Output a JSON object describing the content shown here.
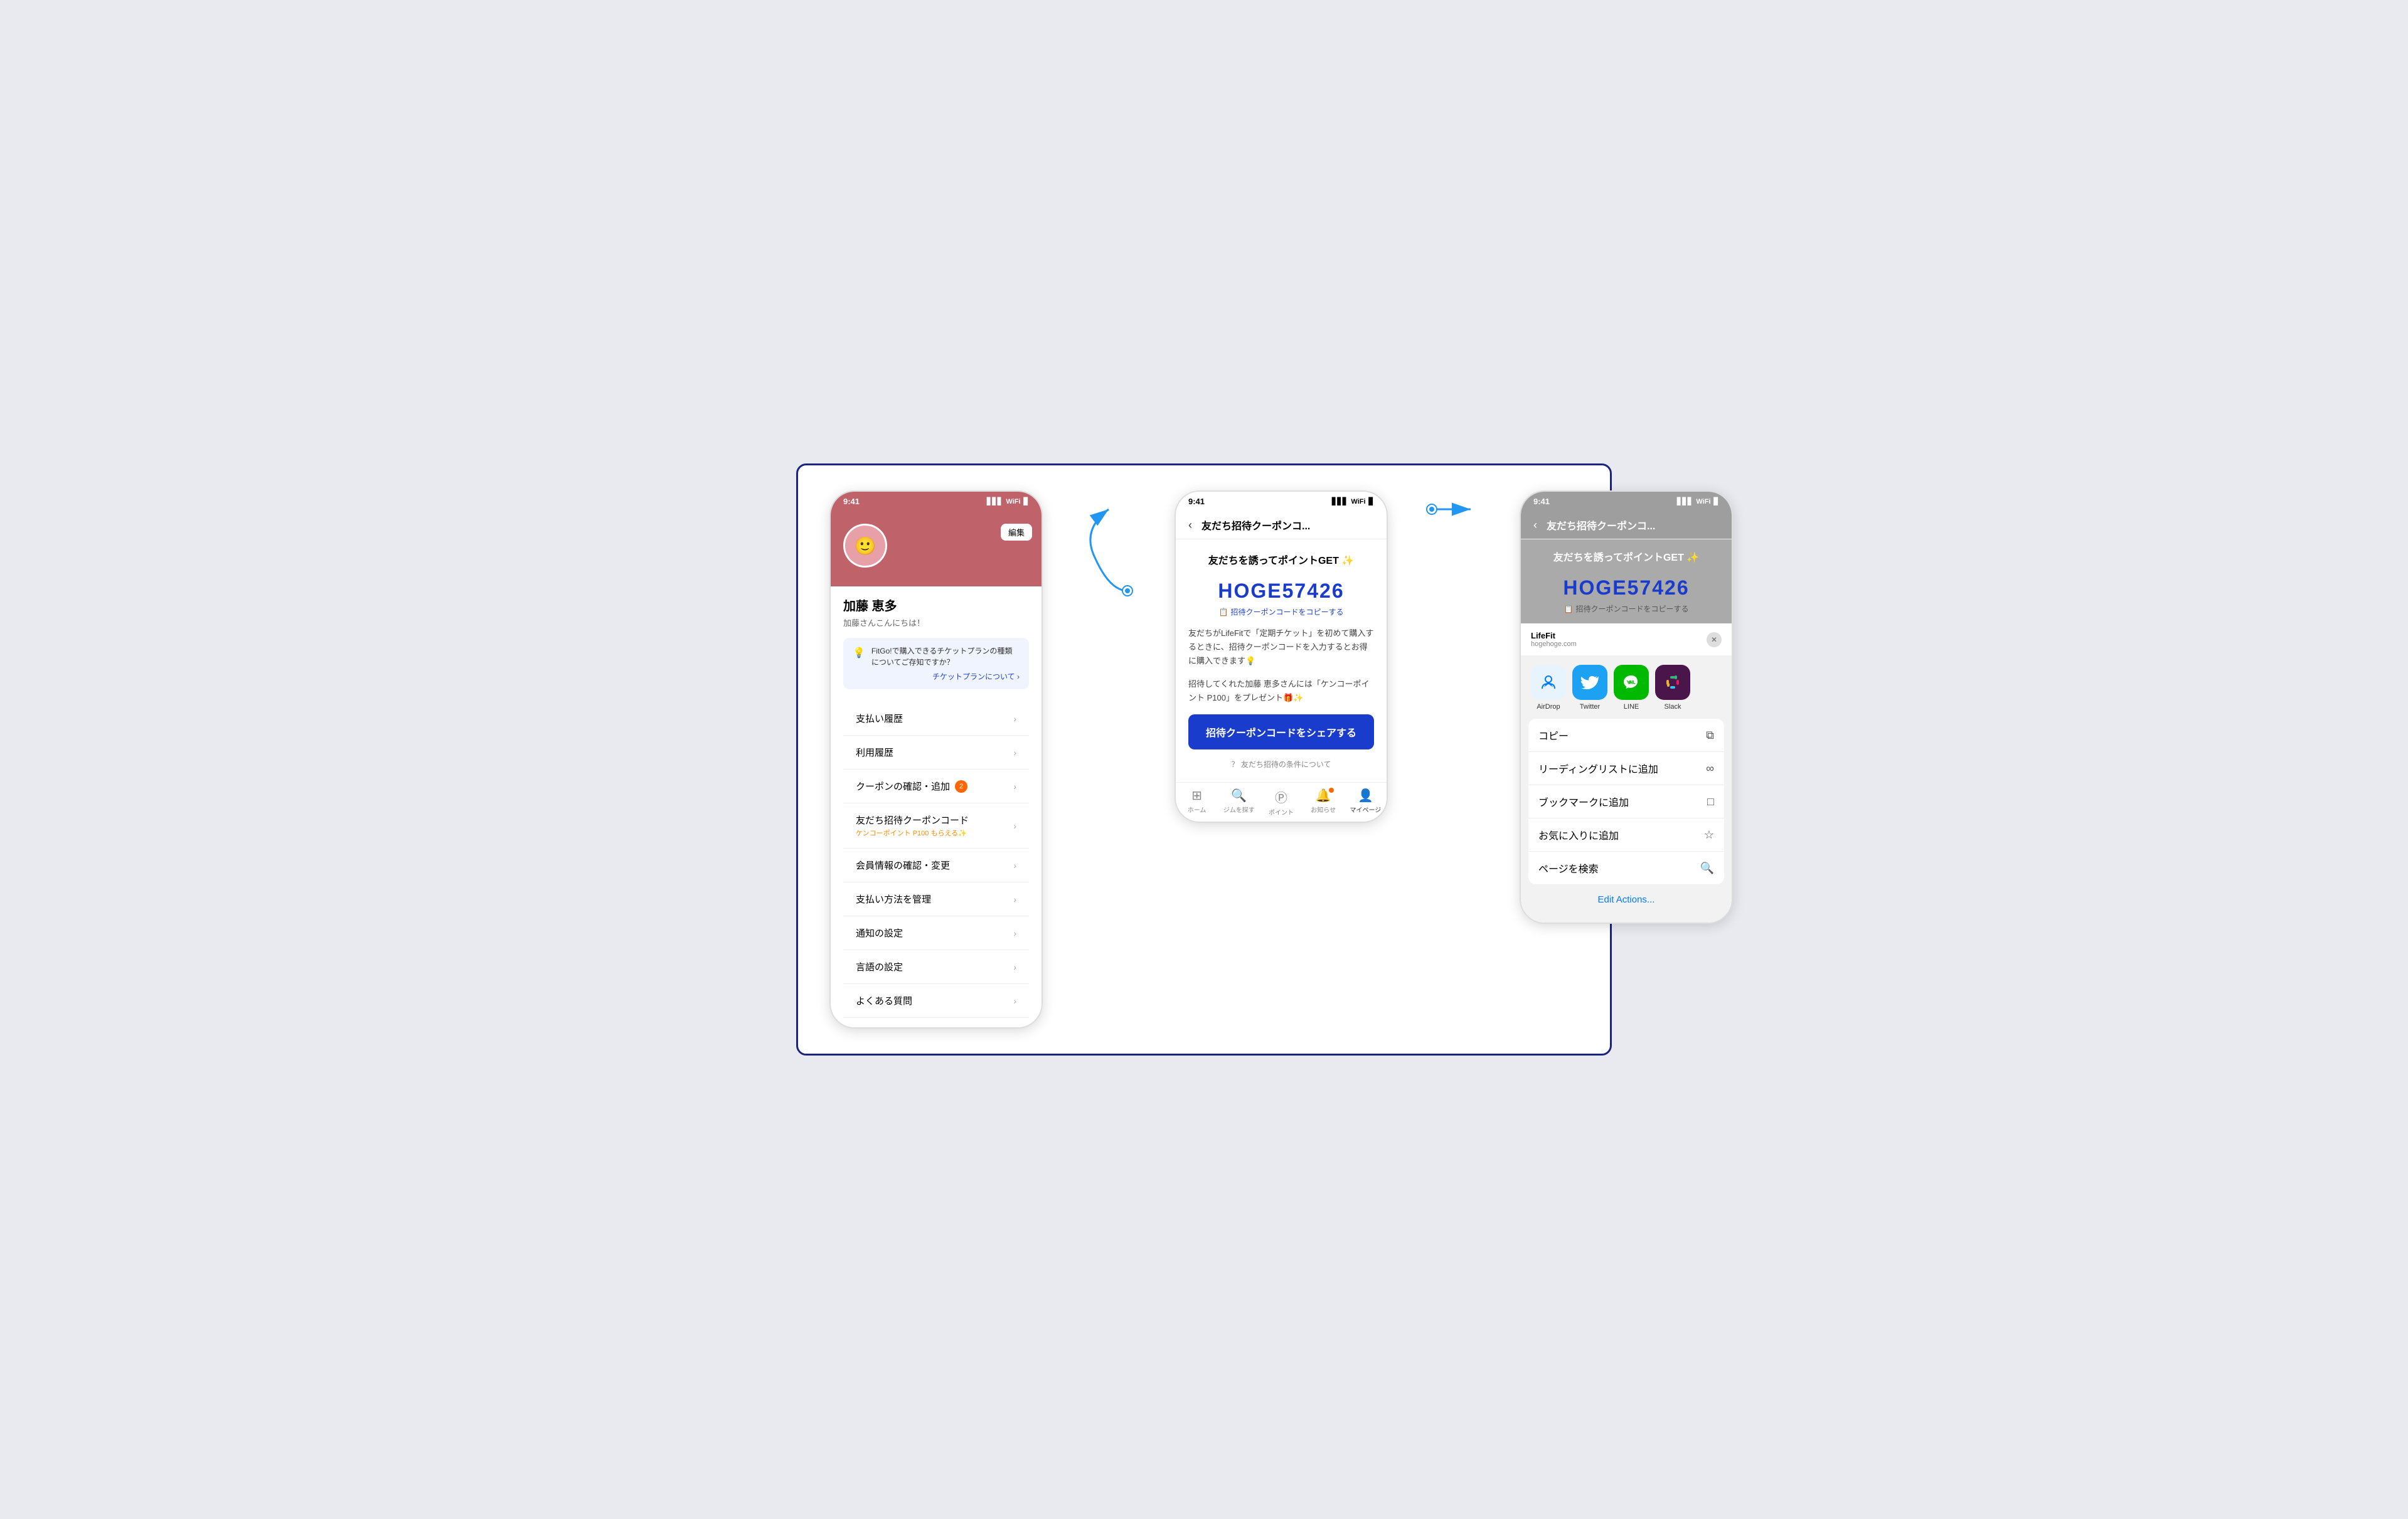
{
  "statusBar": {
    "time": "9:41",
    "signal": "▋▋▋",
    "wifi": "WiFi",
    "battery": "🔋"
  },
  "screen1": {
    "editLabel": "編集",
    "profileName": "加藤 恵多",
    "profileGreeting": "加藤さんこんにちは！",
    "tipText": "FitGo!で購入できるチケットプランの種類についてご存知ですか？",
    "tipLinkText": "チケットプランについて ›",
    "menuItems": [
      {
        "label": "支払い履歴",
        "badge": null,
        "sub": null
      },
      {
        "label": "利用履歴",
        "badge": null,
        "sub": null
      },
      {
        "label": "クーポンの確認・追加",
        "badge": "2",
        "sub": null
      },
      {
        "label": "友だち招待クーポンコード",
        "badge": null,
        "sub": "ケンコーポイント P100 もらえる✨"
      },
      {
        "label": "会員情報の確認・変更",
        "badge": null,
        "sub": null
      },
      {
        "label": "支払い方法を管理",
        "badge": null,
        "sub": null
      },
      {
        "label": "通知の設定",
        "badge": null,
        "sub": null
      },
      {
        "label": "言語の設定",
        "badge": null,
        "sub": null
      },
      {
        "label": "よくある質問",
        "badge": null,
        "sub": null
      }
    ]
  },
  "screen2": {
    "navBack": "‹",
    "navTitle": "友だち招待クーポンコ...",
    "headline": "友だちを誘ってポイントGET ✨",
    "couponCode": "HOGE57426",
    "copyText": "招待クーポンコードをコピーする",
    "desc1": "友だちがLifeFitで「定期チケット」を初めて購入するときに、招待クーポンコードを入力するとお得に購入できます💡",
    "desc2": "招待してくれた加藤 恵多さんには「ケンコーポイント P100」をプレゼント🎁✨",
    "shareBtn": "招待クーポンコードをシェアする",
    "conditionText": "友だち招待の条件について"
  },
  "screen3": {
    "navBack": "‹",
    "navTitle": "友だち招待クーポンコ...",
    "headline": "友だちを誘ってポイントGET ✨",
    "couponCode": "HOGE57426",
    "copyText": "招待クーポンコードをコピーする",
    "sheetAppTitle": "LifeFit",
    "sheetAppUrl": "hogehoge.com",
    "apps": [
      {
        "name": "AirDrop",
        "type": "airdrop"
      },
      {
        "name": "Twitter",
        "type": "twitter"
      },
      {
        "name": "LINE",
        "type": "line"
      },
      {
        "name": "Slack",
        "type": "slack"
      }
    ],
    "actions": [
      {
        "label": "コピー",
        "icon": "copy"
      },
      {
        "label": "リーディングリストに追加",
        "icon": "glasses"
      },
      {
        "label": "ブックマークに追加",
        "icon": "book"
      },
      {
        "label": "お気に入りに追加",
        "icon": "star"
      },
      {
        "label": "ページを検索",
        "icon": "search"
      }
    ],
    "editActions": "Edit Actions..."
  },
  "tabBar": {
    "tabs": [
      {
        "label": "ホーム",
        "icon": "⊞"
      },
      {
        "label": "ジムを探す",
        "icon": "🔍"
      },
      {
        "label": "ポイント",
        "icon": "Ⓟ"
      },
      {
        "label": "お知らせ",
        "icon": "🔔",
        "notif": true
      },
      {
        "label": "マイページ",
        "icon": "👤",
        "active": true
      }
    ]
  }
}
